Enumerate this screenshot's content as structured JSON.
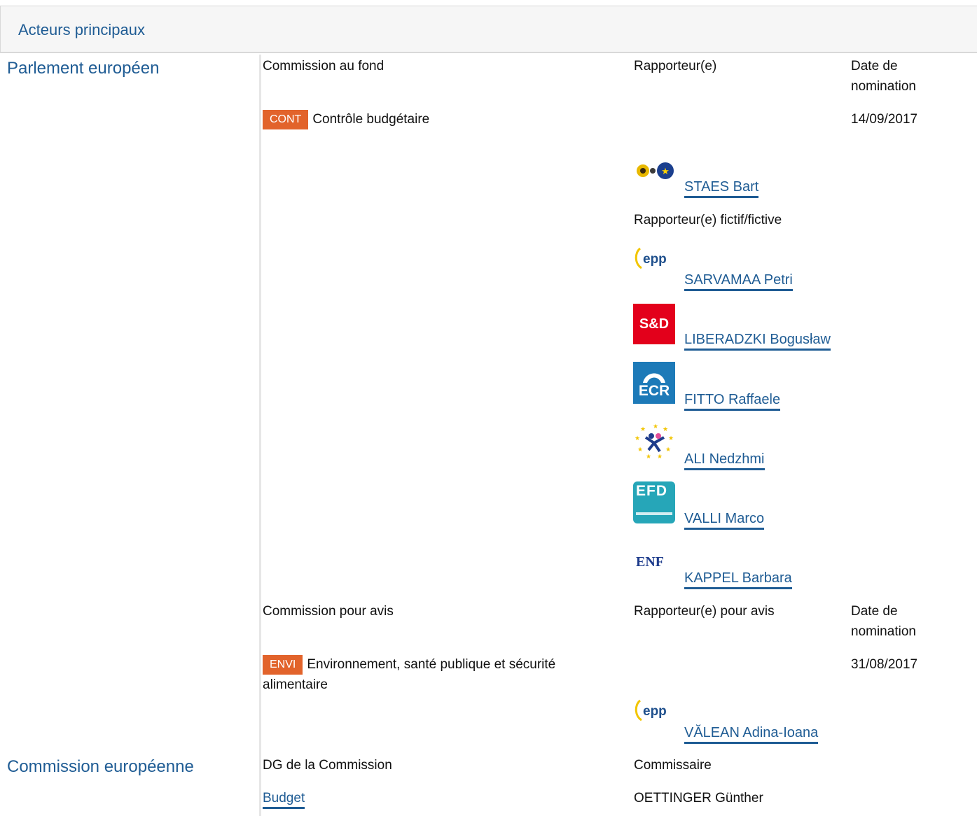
{
  "section_title": "Acteurs principaux",
  "parliament": {
    "label": "Parlement européen",
    "main": {
      "col_committee": "Commission au fond",
      "col_rapporteur": "Rapporteur(e)",
      "col_date": "Date de nomination",
      "committee_code": "CONT",
      "committee_name": "Contrôle budgétaire",
      "date": "14/09/2017",
      "rapporteur": "STAES Bart",
      "shadow_label": "Rapporteur(e) fictif/fictive",
      "shadows": [
        {
          "name": "SARVAMAA Petri",
          "group_logo": "epp-logo"
        },
        {
          "name": "LIBERADZKI Bogusław",
          "group_logo": "s-and-d-logo"
        },
        {
          "name": "FITTO Raffaele",
          "group_logo": "ecr-logo"
        },
        {
          "name": "ALI Nedzhmi",
          "group_logo": "alde-logo"
        },
        {
          "name": "VALLI Marco",
          "group_logo": "efdd-logo"
        },
        {
          "name": "KAPPEL Barbara",
          "group_logo": "enf-logo"
        }
      ]
    },
    "opinion": {
      "col_committee": "Commission pour avis",
      "col_rapporteur": "Rapporteur(e) pour avis",
      "col_date": "Date de nomination",
      "committee_code": "ENVI",
      "committee_name": "Environnement, santé publique et sécurité alimentaire",
      "date": "31/08/2017",
      "rapporteur": "VĂLEAN Adina-Ioana"
    }
  },
  "commission": {
    "label": "Commission européenne",
    "col_dg": "DG de la Commission",
    "col_commissioner": "Commissaire",
    "dg": "Budget",
    "commissioner": "OETTINGER Günther"
  },
  "logo_text": {
    "sd": "S&D",
    "ecr": "ECR",
    "enf": "ENF",
    "epp": "epp",
    "efd": "EFD"
  },
  "colors": {
    "link": "#1f5c94",
    "badge": "#e2632b"
  }
}
